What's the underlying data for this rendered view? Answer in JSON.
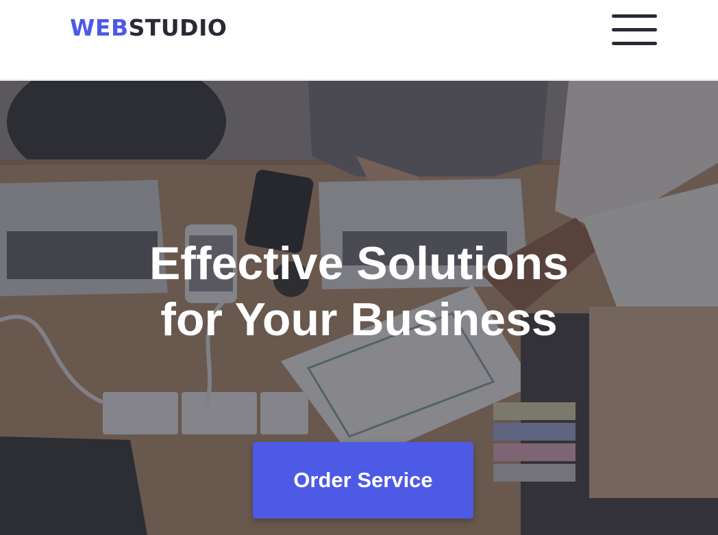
{
  "header": {
    "logo": {
      "accent": "WEB",
      "rest": "STUDIO"
    },
    "menu_icon": "hamburger-menu-icon"
  },
  "hero": {
    "title_line1": "Effective Solutions",
    "title_line2": "for Your Business",
    "cta_label": "Order Service",
    "background": "office-desk-photo"
  },
  "colors": {
    "accent": "#4d5ae5",
    "text_dark": "#2a2a35",
    "overlay": "#2f303a"
  }
}
